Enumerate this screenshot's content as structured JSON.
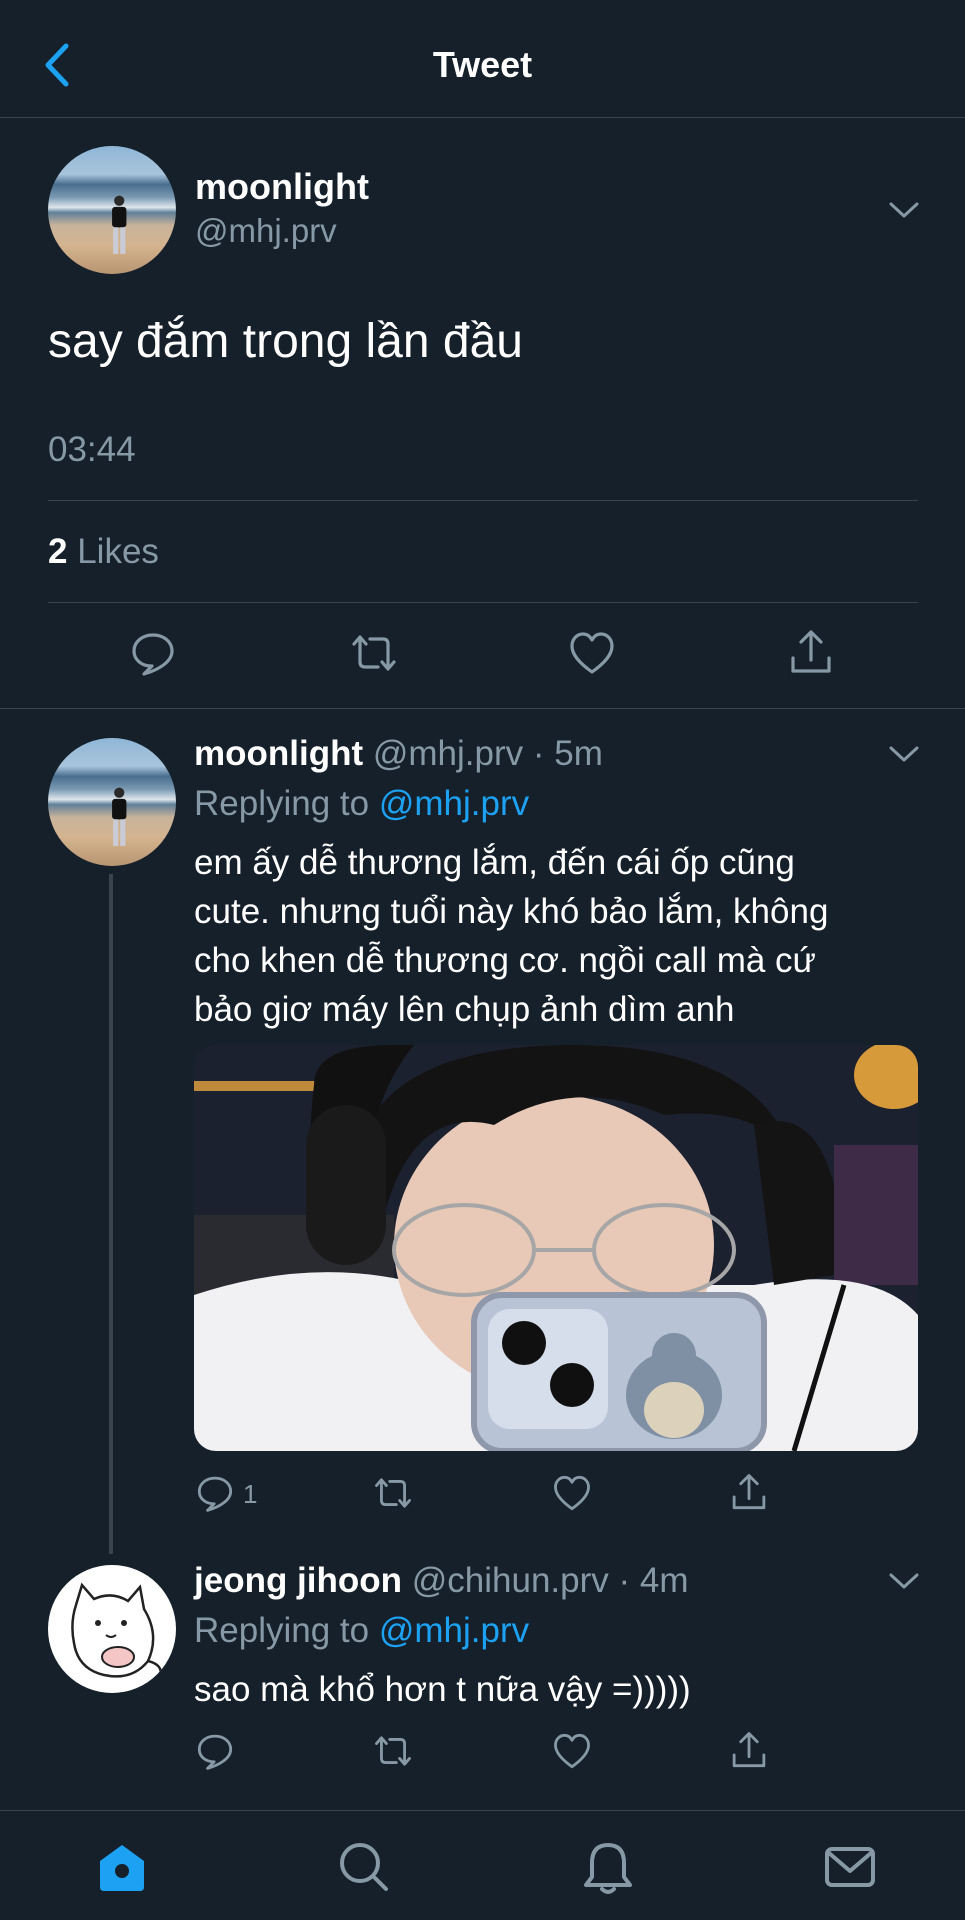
{
  "header": {
    "title": "Tweet"
  },
  "main_tweet": {
    "name": "moonlight",
    "handle": "@mhj.prv",
    "text": "say đắm trong lần đầu",
    "time": "03:44",
    "likes_count": "2",
    "likes_label": "Likes"
  },
  "replies": [
    {
      "name": "moonlight",
      "handle_time": "@mhj.prv · 5m",
      "replying_prefix": "Replying to",
      "replying_to": "@mhj.prv",
      "text_lines": [
        "em ấy dễ thương lắm, đến cái ốp cũng",
        "cute. nhưng tuổi này khó bảo lắm, không",
        "cho khen dễ thương cơ. ngồi call mà cứ",
        "bảo giơ máy lên chụp ảnh dìm anh"
      ],
      "reply_count": "1"
    },
    {
      "name": "jeong jihoon",
      "handle_time": "@chihun.prv · 4m",
      "replying_prefix": "Replying to",
      "replying_to": "@mhj.prv",
      "text": "sao mà khổ hơn t nữa vậy =)))))"
    }
  ],
  "colors": {
    "background": "#15202b",
    "divider": "#38444d",
    "secondary_text": "#8899a6",
    "accent": "#1da1f2"
  },
  "icons": {
    "header": [
      "back-chevron-icon"
    ],
    "actions": [
      "reply-icon",
      "retweet-icon",
      "like-icon",
      "share-icon"
    ],
    "tabs": [
      "home-icon",
      "search-icon",
      "notifications-icon",
      "messages-icon"
    ]
  }
}
